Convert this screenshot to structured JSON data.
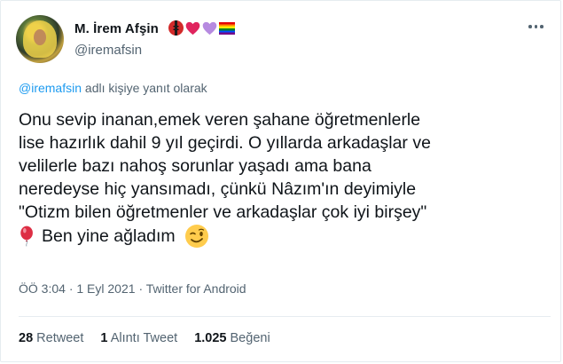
{
  "author": {
    "name": "M. İrem Afşin",
    "handle": "@iremafsin",
    "emojis": [
      "ladybug-icon",
      "red-heart-icon",
      "purple-heart-icon",
      "rainbow-flag-icon"
    ]
  },
  "reply": {
    "mention": "@iremafsin",
    "suffix": " adlı kişiye yanıt olarak"
  },
  "tweet": {
    "lines": [
      "Onu sevip inanan,emek veren şahane öğretmenlerle",
      "lise hazırlık dahil 9 yıl geçirdi. O yıllarda arkadaşlar ve",
      "velilerle bazı nahoş sorunlar yaşadı ama bana",
      "neredeyse hiç yansımadı, çünkü Nâzım'ın deyimiyle",
      "\"Otizm bilen öğretmenler ve arkadaşlar çok iyi birşey\""
    ],
    "last_line_text": "Ben yine ağladım",
    "last_line_emojis": [
      "balloon-icon",
      "winking-face-icon"
    ]
  },
  "meta": {
    "time": "ÖÖ 3:04",
    "date": "1 Eyl 2021",
    "source": "Twitter for Android",
    "separator": "·"
  },
  "stats": {
    "retweets_count": "28",
    "retweets_label": "Retweet",
    "quotes_count": "1",
    "quotes_label": "Alıntı Tweet",
    "likes_count": "1.025",
    "likes_label": "Beğeni"
  },
  "colors": {
    "text": "#0f1419",
    "secondary": "#536471",
    "link": "#1d9bf0",
    "divider": "#e6ecf0"
  }
}
